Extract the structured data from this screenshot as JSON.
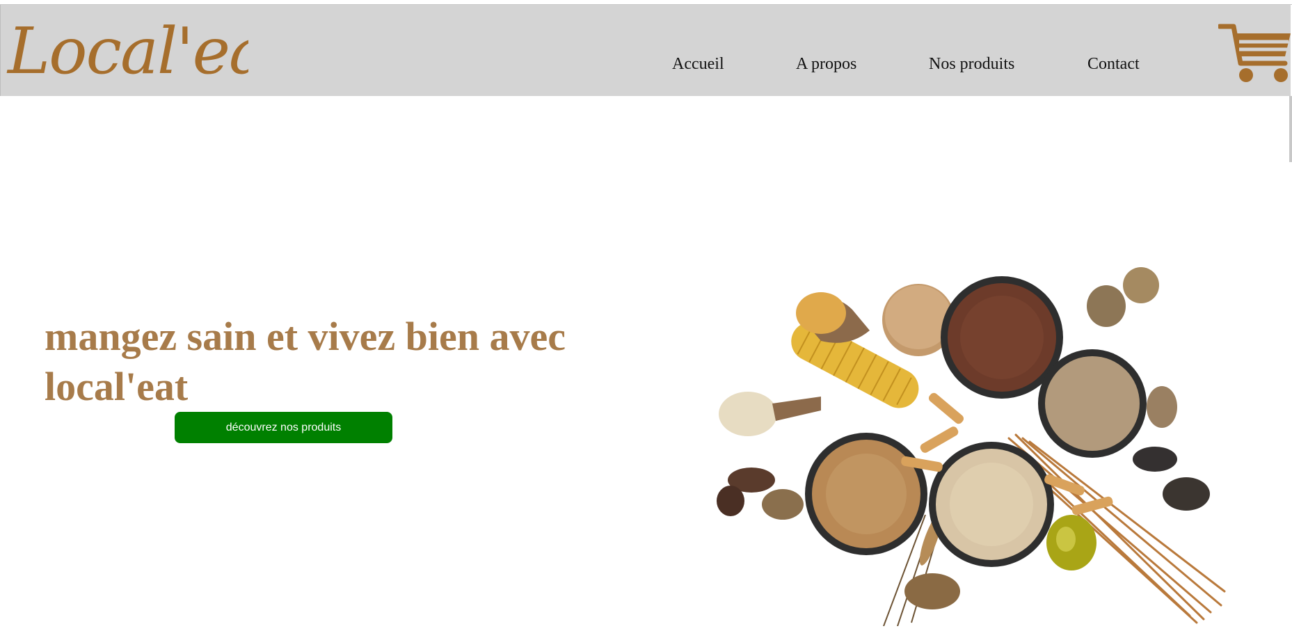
{
  "brand": {
    "logo_text": "Local'eat",
    "color": "#a66e2c"
  },
  "nav": {
    "items": [
      {
        "label": "Accueil"
      },
      {
        "label": "A propos"
      },
      {
        "label": "Nos produits"
      },
      {
        "label": "Contact"
      }
    ]
  },
  "hero": {
    "title_line1": "mangez sain et vivez bien avec",
    "title_line2": "local'eat",
    "title_color": "#a77b4a",
    "cta_label": "découvrez nos produits",
    "cta_color": "#008000"
  },
  "icons": {
    "cart": "shopping-cart-icon"
  }
}
